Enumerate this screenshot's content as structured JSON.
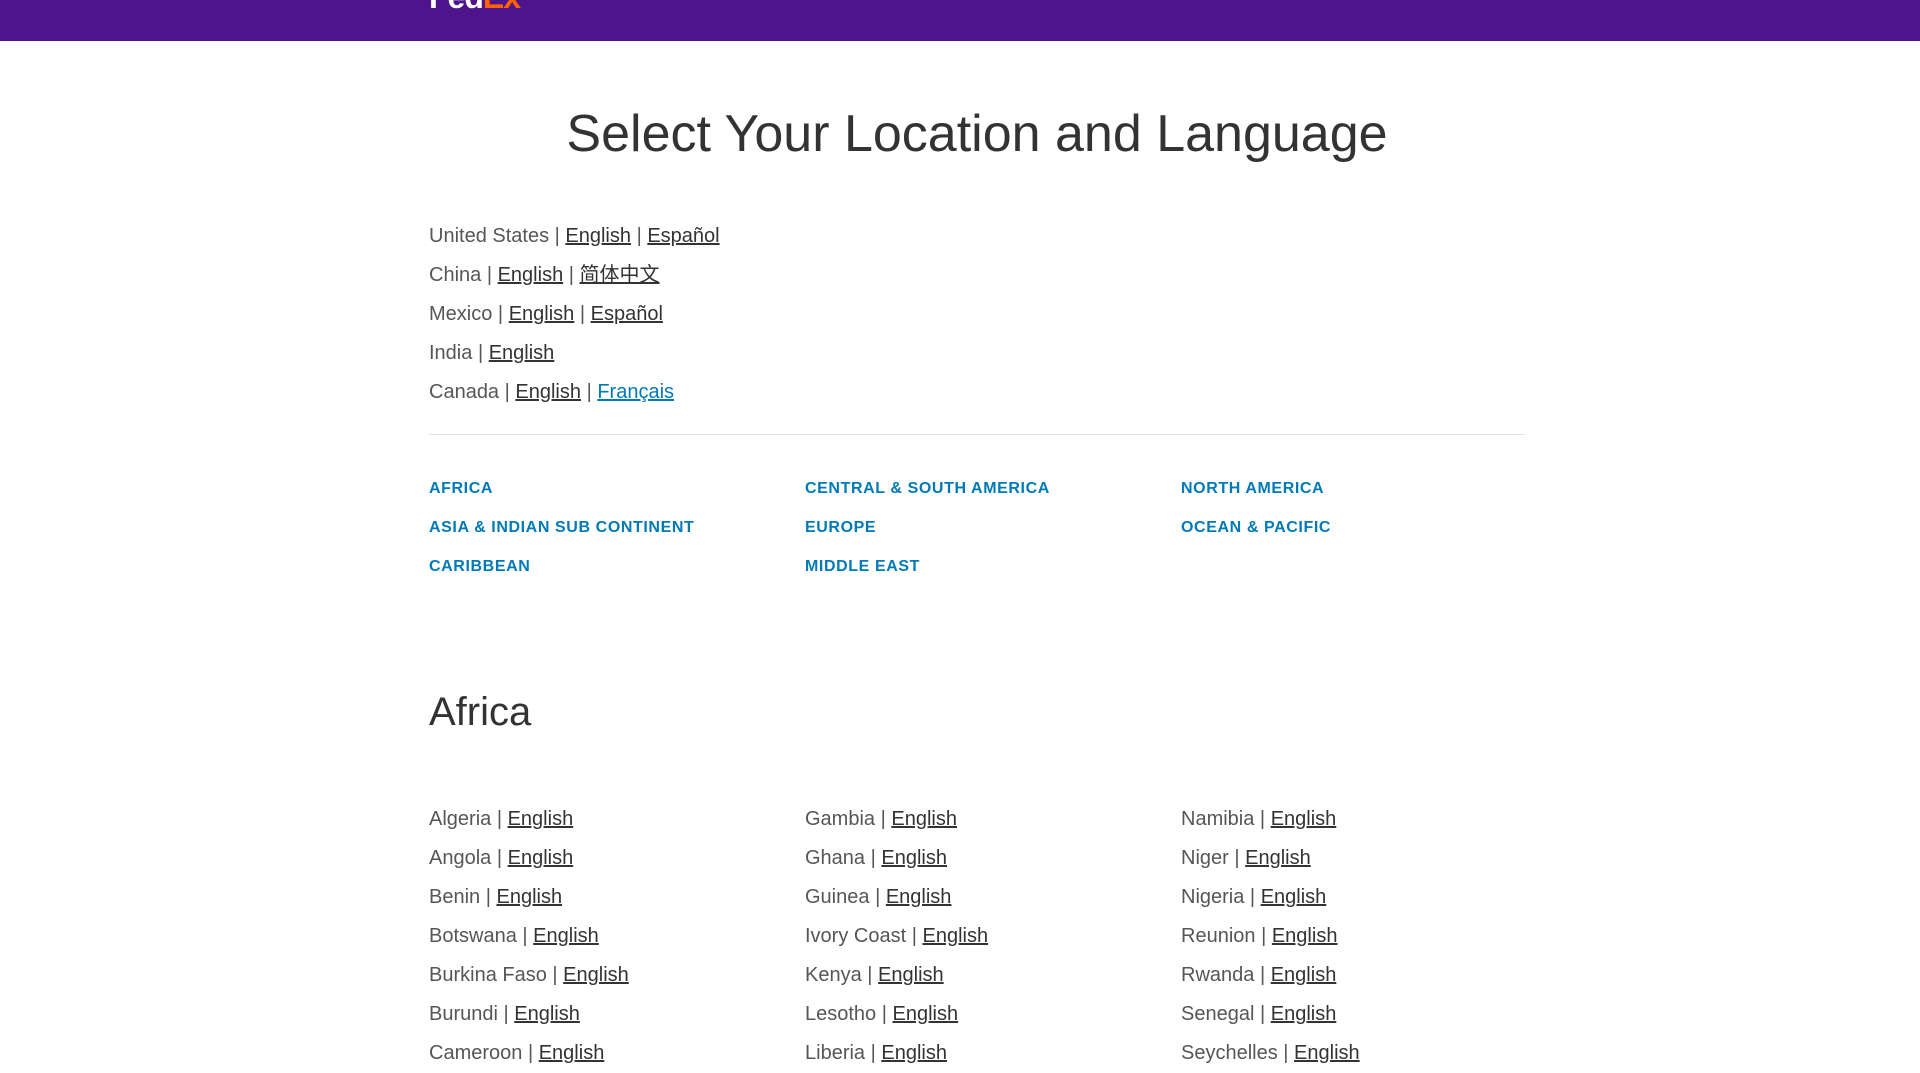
{
  "header": {
    "logo_main": "Fed",
    "logo_ex": "Ex"
  },
  "page_title": "Select Your Location and Language",
  "separator": "|",
  "featured": [
    {
      "country": "United States",
      "languages": [
        "English",
        "Español"
      ]
    },
    {
      "country": "China",
      "languages": [
        "English",
        "简体中文"
      ]
    },
    {
      "country": "Mexico",
      "languages": [
        "English",
        "Español"
      ]
    },
    {
      "country": "India",
      "languages": [
        "English"
      ]
    },
    {
      "country": "Canada",
      "languages": [
        "English",
        "Français"
      ]
    }
  ],
  "regions": [
    "Africa",
    "Central & South America",
    "North America",
    "Asia & Indian Sub Continent",
    "Europe",
    "Ocean & Pacific",
    "Caribbean",
    "Middle East"
  ],
  "section": {
    "title": "Africa",
    "columns": [
      [
        {
          "country": "Algeria",
          "language": "English"
        },
        {
          "country": "Angola",
          "language": "English"
        },
        {
          "country": "Benin",
          "language": "English"
        },
        {
          "country": "Botswana",
          "language": "English"
        },
        {
          "country": "Burkina Faso",
          "language": "English"
        },
        {
          "country": "Burundi",
          "language": "English"
        },
        {
          "country": "Cameroon",
          "language": "English"
        }
      ],
      [
        {
          "country": "Gambia",
          "language": "English"
        },
        {
          "country": "Ghana",
          "language": "English"
        },
        {
          "country": "Guinea",
          "language": "English"
        },
        {
          "country": "Ivory Coast",
          "language": "English"
        },
        {
          "country": "Kenya",
          "language": "English"
        },
        {
          "country": "Lesotho",
          "language": "English"
        },
        {
          "country": "Liberia",
          "language": "English"
        }
      ],
      [
        {
          "country": "Namibia",
          "language": "English"
        },
        {
          "country": "Niger",
          "language": "English"
        },
        {
          "country": "Nigeria",
          "language": "English"
        },
        {
          "country": "Reunion",
          "language": "English"
        },
        {
          "country": "Rwanda",
          "language": "English"
        },
        {
          "country": "Senegal",
          "language": "English"
        },
        {
          "country": "Seychelles",
          "language": "English"
        }
      ]
    ]
  },
  "colors": {
    "header_bg": "#4d148c",
    "link_blue": "#007ab7",
    "logo_orange": "#ff6200"
  }
}
